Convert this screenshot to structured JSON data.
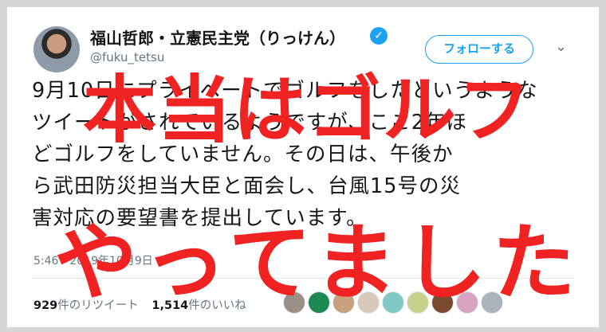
{
  "tweet": {
    "author_name": "福山哲郎・立憲民主党（りっけん）",
    "handle": "@fuku_tetsu",
    "follow_label": "フォローする",
    "lines": [
      "9月10日にプライベートでゴルフをしたというような",
      "ツイートがされているようですが、ここ2年ほ",
      "どゴルフをしていません。その日は、午後か",
      "ら武田防災担当大臣と面会し、台風15号の災",
      "害対応の要望書を提出しています。"
    ],
    "timestamp": "5:46 - 2019年10月9日",
    "retweets_count": "929",
    "retweets_label": "件のリツイート",
    "likes_count": "1,514",
    "likes_label": "件のいいね"
  },
  "overlay": {
    "line1": "本当はゴルフ",
    "line2": "やってました",
    "color": "#f02222"
  },
  "liker_avatars": [
    "#9a8f86",
    "#1d8a52",
    "#c8a07e",
    "#d7c9b8",
    "#7fc8c4",
    "#c6d08a",
    "#7a4a2e",
    "#d9a3c2",
    "#aab3bc"
  ]
}
